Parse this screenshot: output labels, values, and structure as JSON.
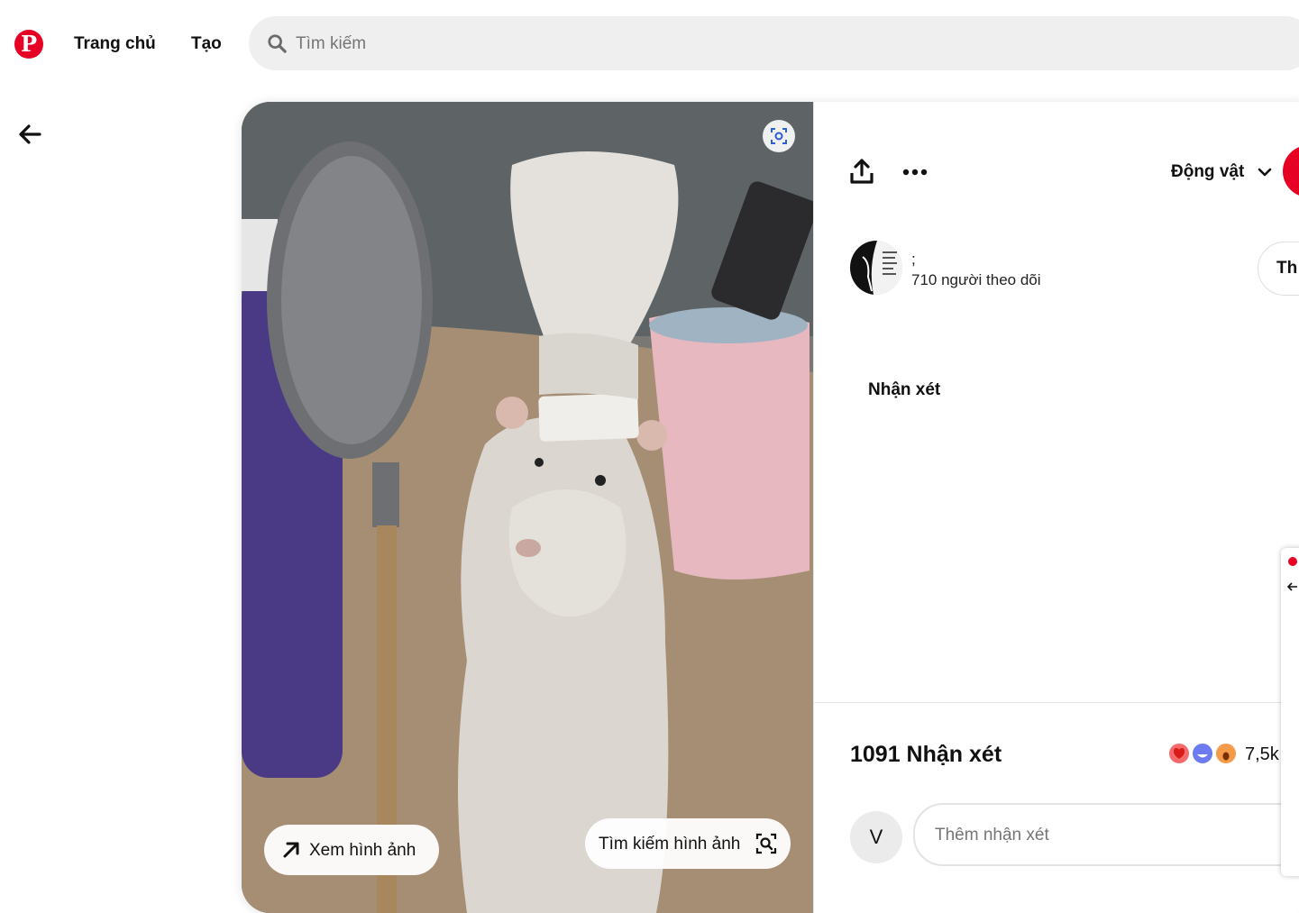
{
  "header": {
    "logo_letter": "P",
    "nav": {
      "home": "Trang chủ",
      "create": "Tạo"
    },
    "search": {
      "placeholder": "Tìm kiếm"
    }
  },
  "pin": {
    "image_alt": "Chuột trắng đội mũ đầu bếp cầm muỗng",
    "view_image_label": "Xem hình ảnh",
    "search_image_label": "Tìm kiếm hình ảnh"
  },
  "panel": {
    "board_label": "Động vật",
    "save_label": "",
    "creator": {
      "name": ";",
      "followers": "710 người theo dõi"
    },
    "follow_label": "Th",
    "comments_title": "Nhận xét",
    "comment_count": "1091 Nhận xét",
    "reaction_count": "7,5k",
    "user_initial": "V",
    "comment_placeholder": "Thêm nhận xét"
  },
  "colors": {
    "brand": "#e60023",
    "search_bg": "#efefef"
  }
}
